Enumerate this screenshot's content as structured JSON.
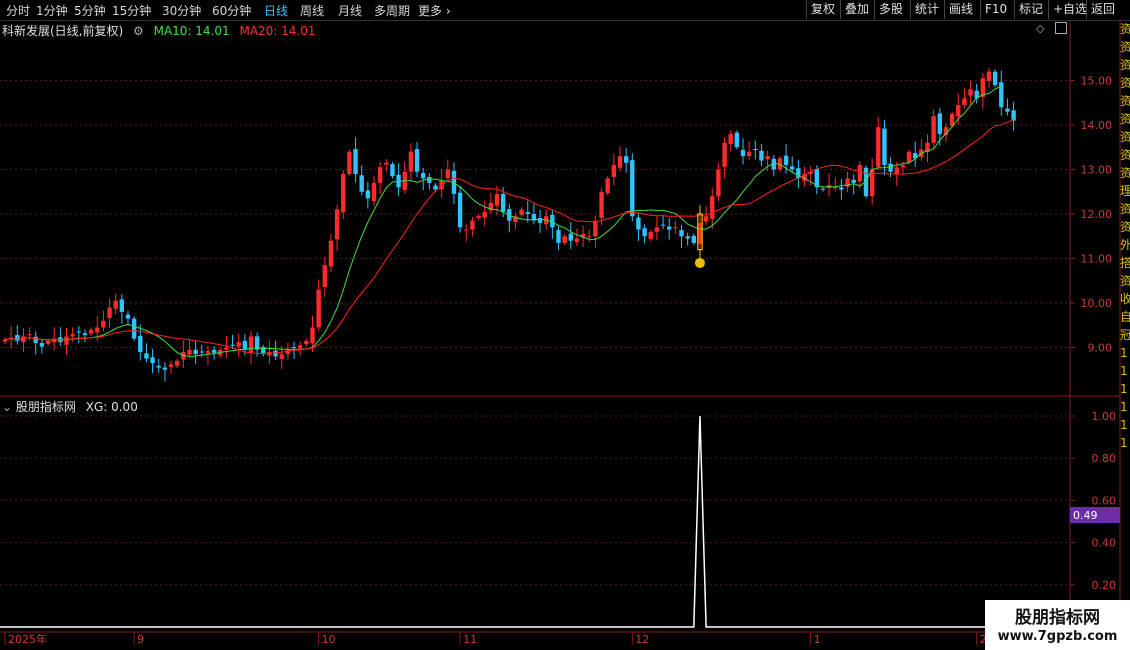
{
  "toolbar": {
    "periods": [
      "分时",
      "1分钟",
      "5分钟",
      "15分钟",
      "30分钟",
      "60分钟",
      "日线",
      "周线",
      "月线",
      "多周期",
      "更多 ›"
    ],
    "active_period": "日线",
    "buttons": [
      "复权",
      "叠加",
      "多股",
      "统计",
      "画线",
      "F10",
      "标记",
      "+自选",
      "返回"
    ]
  },
  "main_header": {
    "title": "科新发展(日线,前复权)",
    "ma10_label": "MA10: 14.01",
    "ma20_label": "MA20: 14.01"
  },
  "colors": {
    "up": "#ff2a2a",
    "down": "#2fc3ff",
    "ma10": "#3fe03f",
    "ma20": "#ff2020",
    "signal": "#ffffff",
    "badge": "#6b2ea8",
    "gold": "#e8c000",
    "grid": "#5a1a1a"
  },
  "price_axis": {
    "ticks": [
      "15.00",
      "14.00",
      "13.00",
      "12.00",
      "11.00",
      "10.00",
      "9.00"
    ],
    "min": 8.0,
    "max": 16.0
  },
  "indicator": {
    "title": "股朋指标网",
    "xg_label": "XG: 0.00",
    "ticks": [
      "1.00",
      "0.80",
      "0.60",
      "0.40",
      "0.20"
    ],
    "badge_value": "0.49",
    "signal_index": 113
  },
  "date_axis": {
    "labels": [
      {
        "text": "2025年",
        "index": 0
      },
      {
        "text": "9",
        "index": 21
      },
      {
        "text": "10",
        "index": 51
      },
      {
        "text": "11",
        "index": 74
      },
      {
        "text": "12",
        "index": 102
      },
      {
        "text": "1",
        "index": 131
      },
      {
        "text": "2",
        "index": 158
      }
    ]
  },
  "chart_data": {
    "type": "candlestick",
    "closes": [
      9.18,
      9.22,
      9.15,
      9.25,
      9.3,
      9.1,
      9.02,
      9.15,
      9.2,
      9.12,
      9.25,
      9.3,
      9.35,
      9.28,
      9.4,
      9.45,
      9.6,
      9.9,
      10.05,
      9.8,
      9.65,
      9.2,
      8.9,
      8.75,
      8.65,
      8.55,
      8.5,
      8.62,
      8.7,
      8.9,
      8.95,
      8.85,
      8.9,
      8.92,
      8.88,
      8.95,
      9.0,
      9.05,
      9.12,
      8.95,
      9.25,
      8.95,
      8.85,
      8.9,
      8.8,
      8.85,
      8.95,
      9.0,
      9.05,
      9.15,
      9.45,
      10.3,
      10.85,
      11.4,
      12.1,
      12.9,
      13.4,
      12.9,
      12.5,
      12.35,
      12.7,
      13.05,
      13.15,
      12.85,
      12.6,
      12.95,
      13.4,
      12.95,
      12.8,
      12.7,
      12.55,
      12.75,
      13.0,
      12.45,
      11.7,
      11.65,
      11.85,
      11.95,
      12.05,
      12.25,
      12.45,
      12.05,
      11.85,
      11.95,
      12.1,
      12.0,
      11.85,
      11.8,
      11.95,
      11.7,
      11.35,
      11.5,
      11.4,
      11.45,
      11.55,
      11.5,
      11.85,
      12.5,
      12.8,
      13.1,
      13.3,
      13.15,
      11.95,
      11.65,
      11.5,
      11.6,
      11.7,
      11.75,
      11.65,
      11.7,
      11.5,
      11.45,
      11.35,
      11.8,
      11.95,
      12.4,
      13.0,
      13.6,
      13.8,
      13.5,
      13.3,
      13.4,
      13.45,
      13.2,
      13.3,
      13.0,
      13.25,
      13.1,
      13.0,
      12.8,
      12.9,
      12.95,
      12.6,
      12.55,
      12.65,
      12.6,
      12.55,
      12.8,
      12.7,
      13.1,
      12.4,
      13.0,
      13.95,
      13.1,
      12.95,
      13.05,
      13.1,
      13.4,
      13.25,
      13.45,
      13.6,
      14.2,
      13.8,
      13.95,
      14.25,
      14.45,
      14.6,
      14.8,
      14.6,
      15.05,
      15.2,
      14.9,
      14.4,
      14.3,
      14.1
    ],
    "ma10": [
      9.18,
      9.2,
      9.18,
      9.2,
      9.22,
      9.2,
      9.18,
      9.17,
      9.17,
      9.17,
      9.18,
      9.19,
      9.21,
      9.21,
      9.22,
      9.24,
      9.28,
      9.35,
      9.43,
      9.48,
      9.52,
      9.48,
      9.43,
      9.38,
      9.32,
      9.24,
      9.14,
      9.01,
      8.89,
      8.82,
      8.8,
      8.81,
      8.83,
      8.85,
      8.86,
      8.89,
      8.91,
      8.93,
      8.95,
      8.96,
      8.98,
      8.99,
      8.98,
      8.98,
      8.97,
      8.96,
      8.96,
      8.96,
      8.95,
      8.97,
      9.0,
      9.15,
      9.34,
      9.59,
      9.89,
      10.29,
      10.74,
      11.14,
      11.5,
      11.82,
      12.08,
      12.36,
      12.59,
      12.72,
      12.73,
      12.75,
      12.75,
      12.71,
      12.76,
      12.79,
      12.78,
      12.75,
      12.74,
      12.7,
      12.61,
      12.48,
      12.33,
      12.23,
      12.16,
      12.11,
      12.1,
      12.04,
      11.97,
      11.92,
      11.89,
      11.87,
      11.87,
      11.88,
      11.87,
      11.82,
      11.74,
      11.69,
      11.6,
      11.53,
      11.48,
      11.43,
      11.43,
      11.5,
      11.61,
      11.73,
      11.89,
      12.05,
      12.06,
      12.08,
      12.08,
      12.09,
      12.08,
      12.08,
      12.05,
      12.01,
      11.9,
      11.77,
      11.71,
      11.66,
      11.66,
      11.74,
      11.87,
      12.03,
      12.18,
      12.32,
      12.5,
      12.66,
      12.84,
      12.96,
      13.07,
      13.14,
      13.12,
      13.03,
      12.94,
      12.86,
      12.81,
      12.72,
      12.64,
      12.61,
      12.61,
      12.61,
      12.64,
      12.65,
      12.68,
      12.63,
      12.74,
      13.0,
      13.04,
      13.04,
      13.07,
      13.1,
      13.13,
      13.15,
      13.24,
      13.37,
      13.42,
      13.46,
      13.66,
      13.81,
      13.96,
      14.14,
      14.26,
      14.44,
      14.61,
      14.68,
      14.71,
      14.81,
      14.88
    ],
    "signal_value": 1.0,
    "xg_value": 0.0,
    "ma10_last": 14.01,
    "ma20_last": 14.01
  },
  "watermark": {
    "line1": "股朋指标网",
    "line2": "www.7gpzb.com"
  },
  "right_strip": [
    "资",
    "资",
    "资",
    "资",
    "资",
    "资",
    "资",
    "资",
    "资",
    "理",
    "资",
    "资",
    "外",
    "搭",
    "资",
    "收",
    "自",
    "冠",
    "1",
    "1",
    "1",
    "1",
    "1",
    "1"
  ]
}
